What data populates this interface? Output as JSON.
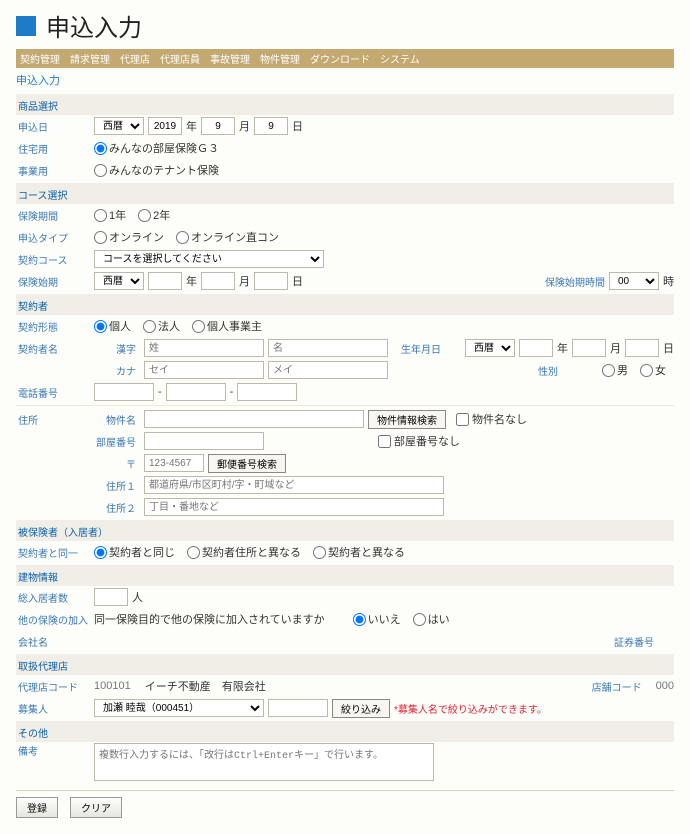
{
  "title": "申込入力",
  "menubar": [
    "契約管理",
    "請求管理",
    "代理店",
    "代理店員",
    "事故管理",
    "物件管理",
    "ダウンロード",
    "システム"
  ],
  "screen_title": "申込入力",
  "sections": {
    "product": "商品選択",
    "course": "コース選択",
    "contractor": "契約者",
    "insured": "被保険者（入居者）",
    "building": "建物情報",
    "agency": "取扱代理店",
    "other": "その他"
  },
  "labels": {
    "apply_date": "申込日",
    "residential": "住宅用",
    "business": "事業用",
    "period": "保険期間",
    "apply_type": "申込タイプ",
    "contract_course": "契約コース",
    "start_date": "保険始期",
    "start_time": "保険始期時間",
    "contract_form": "契約形態",
    "name": "契約者名",
    "kanji": "漢字",
    "kana": "カナ",
    "birth": "生年月日",
    "gender": "性別",
    "phone": "電話番号",
    "address": "住所",
    "building_name": "物件名",
    "room_no": "部屋番号",
    "postal": "〒",
    "addr1": "住所１",
    "addr2": "住所２",
    "same_as": "契約者と同一",
    "occupants": "総入居者数",
    "other_ins": "他の保険の加入",
    "company": "会社名",
    "policy_no": "証券番号",
    "agency_code": "代理店コード",
    "store_code": "店舗コード",
    "recruiter": "募集人",
    "remarks": "備考"
  },
  "apply_date": {
    "era_options": [
      "西暦"
    ],
    "year": "2019",
    "month": "9",
    "day": "9",
    "y_suf": "年",
    "m_suf": "月",
    "d_suf": "日"
  },
  "products": {
    "residential": "みんなの部屋保険Ｇ３",
    "business": "みんなのテナント保険"
  },
  "period": {
    "opt1": "1年",
    "opt2": "2年"
  },
  "apply_type": {
    "opt1": "オンライン",
    "opt2": "オンライン直コン"
  },
  "course_placeholder": "コースを選択してください",
  "start_date": {
    "era_options": [
      "西暦"
    ],
    "y_suf": "年",
    "m_suf": "月",
    "d_suf": "日"
  },
  "start_time": {
    "options": [
      "00"
    ],
    "suffix": "時"
  },
  "contract_form": {
    "opt1": "個人",
    "opt2": "法人",
    "opt3": "個人事業主"
  },
  "name_placeholder": {
    "sei": "姓",
    "mei": "名",
    "sei_k": "セイ",
    "mei_k": "メイ"
  },
  "birth": {
    "era_options": [
      "西暦"
    ],
    "y_suf": "年",
    "m_suf": "月",
    "d_suf": "日"
  },
  "gender": {
    "m": "男",
    "f": "女"
  },
  "building": {
    "lookup_btn": "物件情報検索",
    "no_building": "物件名なし",
    "no_room": "部屋番号なし",
    "postal_placeholder": "123-4567",
    "postal_btn": "郵便番号検索",
    "addr1_placeholder": "都道府県/市区町村/字・町域など",
    "addr2_placeholder": "丁目・番地など"
  },
  "same_as": {
    "opt1": "契約者と同じ",
    "opt2": "契約者住所と異なる",
    "opt3": "契約者と異なる"
  },
  "occupants_suffix": "人",
  "other_ins_q": "同一保険目的で他の保険に加入されていますか",
  "other_ins": {
    "no": "いいえ",
    "yes": "はい"
  },
  "agency": {
    "code": "100101",
    "name": "イーチ不動産　有限会社",
    "store_code": "000",
    "recruiter_options": [
      "加瀬 睦哉（000451）"
    ],
    "filter_btn": "絞り込み",
    "filter_note": "*募集人名で絞り込みができます。"
  },
  "remarks_placeholder": "複数行入力するには、「改行はCtrl+Enterキー」で行います。",
  "buttons": {
    "register": "登録",
    "clear": "クリア"
  }
}
